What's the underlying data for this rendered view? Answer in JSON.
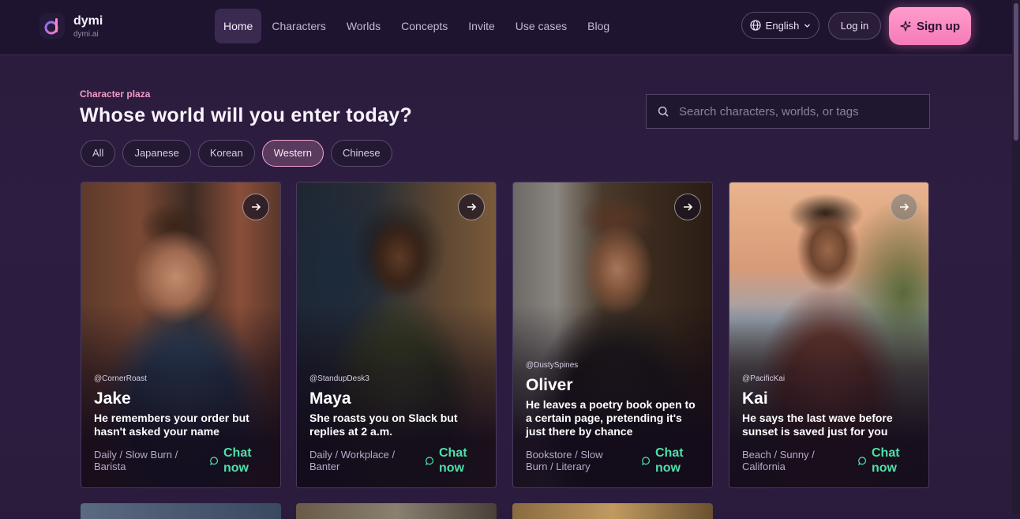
{
  "brand": {
    "name": "dymi",
    "domain": "dymi.ai"
  },
  "nav": [
    {
      "label": "Home",
      "active": true
    },
    {
      "label": "Characters"
    },
    {
      "label": "Worlds"
    },
    {
      "label": "Concepts"
    },
    {
      "label": "Invite"
    },
    {
      "label": "Use cases"
    },
    {
      "label": "Blog"
    }
  ],
  "header": {
    "language": "English",
    "login": "Log in",
    "signup": "Sign up"
  },
  "hero": {
    "eyebrow": "Character plaza",
    "title": "Whose world will you enter today?"
  },
  "search": {
    "placeholder": "Search characters, worlds, or tags"
  },
  "filters": [
    {
      "label": "All"
    },
    {
      "label": "Japanese"
    },
    {
      "label": "Korean"
    },
    {
      "label": "Western",
      "active": true
    },
    {
      "label": "Chinese"
    }
  ],
  "cards": [
    {
      "handle": "@CornerRoast",
      "name": "Jake",
      "tagline": "He remembers your order but hasn't asked your name",
      "tags": "Daily / Slow Burn / Barista",
      "cta": "Chat now"
    },
    {
      "handle": "@StandupDesk3",
      "name": "Maya",
      "tagline": "She roasts you on Slack but replies at 2 a.m.",
      "tags": "Daily / Workplace / Banter",
      "cta": "Chat now"
    },
    {
      "handle": "@DustySpines",
      "name": "Oliver",
      "tagline": "He leaves a poetry book open to a certain page, pretending it's just there by chance",
      "tags": "Bookstore / Slow Burn / Literary",
      "cta": "Chat now"
    },
    {
      "handle": "@PacificKai",
      "name": "Kai",
      "tagline": "He says the last wave before sunset is saved just for you",
      "tags": "Beach / Sunny / California",
      "cta": "Chat now"
    }
  ],
  "colors": {
    "accent_pink": "#f57bb8",
    "chat_green": "#4fe0a8",
    "background": "#2b1c3e"
  }
}
